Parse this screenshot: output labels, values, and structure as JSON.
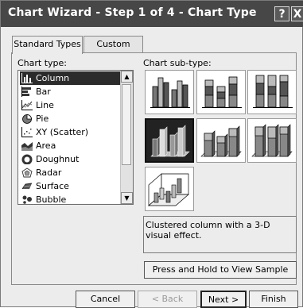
{
  "window": {
    "title": "Chart Wizard - Step 1 of 4 - Chart Type",
    "help_glyph": "?",
    "close_glyph": "X"
  },
  "tabs": [
    {
      "label": "Standard Types",
      "active": true
    },
    {
      "label": "Custom Types",
      "active": false
    }
  ],
  "chart_type": {
    "label": "Chart type:",
    "selected": "Column",
    "items": [
      {
        "label": "Column",
        "icon": "column-chart-icon"
      },
      {
        "label": "Bar",
        "icon": "bar-chart-icon"
      },
      {
        "label": "Line",
        "icon": "line-chart-icon"
      },
      {
        "label": "Pie",
        "icon": "pie-chart-icon"
      },
      {
        "label": "XY (Scatter)",
        "icon": "scatter-chart-icon"
      },
      {
        "label": "Area",
        "icon": "area-chart-icon"
      },
      {
        "label": "Doughnut",
        "icon": "doughnut-chart-icon"
      },
      {
        "label": "Radar",
        "icon": "radar-chart-icon"
      },
      {
        "label": "Surface",
        "icon": "surface-chart-icon"
      },
      {
        "label": "Bubble",
        "icon": "bubble-chart-icon"
      }
    ],
    "scroll_up_glyph": "▲",
    "scroll_down_glyph": "▼"
  },
  "chart_subtype": {
    "label": "Chart sub-type:",
    "selected_index": 3,
    "items": [
      {
        "name": "clustered-column"
      },
      {
        "name": "stacked-column"
      },
      {
        "name": "100-percent-stacked-column"
      },
      {
        "name": "clustered-column-3d-effect"
      },
      {
        "name": "stacked-column-3d-effect"
      },
      {
        "name": "100-percent-stacked-column-3d-effect"
      },
      {
        "name": "3d-column"
      }
    ],
    "description": "Clustered column with a 3-D visual effect."
  },
  "buttons": {
    "view_sample": "Press and Hold to View Sample",
    "cancel": "Cancel",
    "back": "< Back",
    "next": "Next >",
    "finish": "Finish"
  }
}
